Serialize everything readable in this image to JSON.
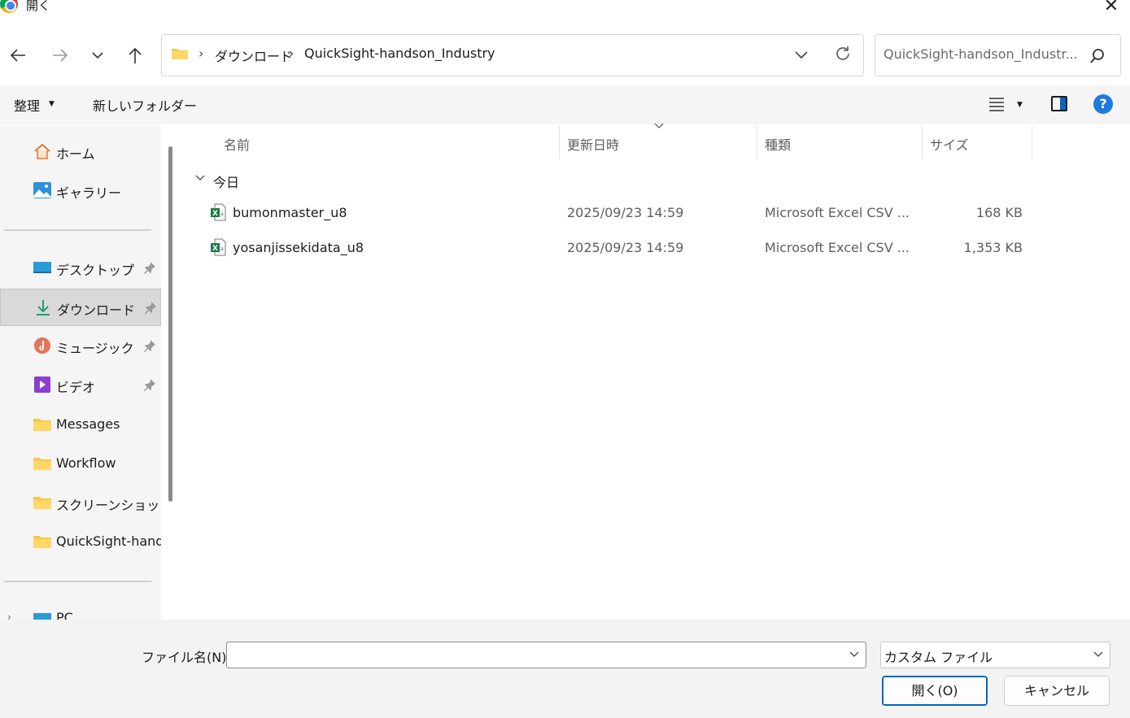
{
  "window": {
    "title": "開く"
  },
  "nav": {
    "breadcrumbs": [
      "ダウンロード",
      "QuickSight-handson_Industry"
    ],
    "search_placeholder": "QuickSight-handson_Industr..."
  },
  "commandbar": {
    "organize": "整理",
    "new_folder": "新しいフォルダー"
  },
  "sidebar": {
    "quick": [
      {
        "label": "ホーム",
        "icon": "home-icon"
      },
      {
        "label": "ギャラリー",
        "icon": "gallery-icon"
      }
    ],
    "pinned": [
      {
        "label": "デスクトップ",
        "icon": "desktop-icon",
        "pinned": true
      },
      {
        "label": "ダウンロード",
        "icon": "download-icon",
        "pinned": true,
        "selected": true
      },
      {
        "label": "ミュージック",
        "icon": "music-icon",
        "pinned": true
      },
      {
        "label": "ビデオ",
        "icon": "video-icon",
        "pinned": true
      },
      {
        "label": "Messages",
        "icon": "folder-icon"
      },
      {
        "label": "Workflow",
        "icon": "folder-icon"
      },
      {
        "label": "スクリーンショット",
        "icon": "folder-icon"
      },
      {
        "label": "QuickSight-handson_Industry",
        "icon": "folder-icon"
      }
    ],
    "pc_label": "PC"
  },
  "columns": {
    "name": "名前",
    "modified": "更新日時",
    "type": "種類",
    "size": "サイズ"
  },
  "group": {
    "label": "今日"
  },
  "files": [
    {
      "name": "bumonmaster_u8",
      "modified": "2025/09/23 14:59",
      "type": "Microsoft Excel CSV ...",
      "size": "168 KB"
    },
    {
      "name": "yosanjissekidata_u8",
      "modified": "2025/09/23 14:59",
      "type": "Microsoft Excel CSV ...",
      "size": "1,353 KB"
    }
  ],
  "bottom": {
    "filename_label": "ファイル名(N):",
    "filename_value": "",
    "filetype": "カスタム ファイル",
    "open_button": "開く(O)",
    "cancel_button": "キャンセル"
  }
}
